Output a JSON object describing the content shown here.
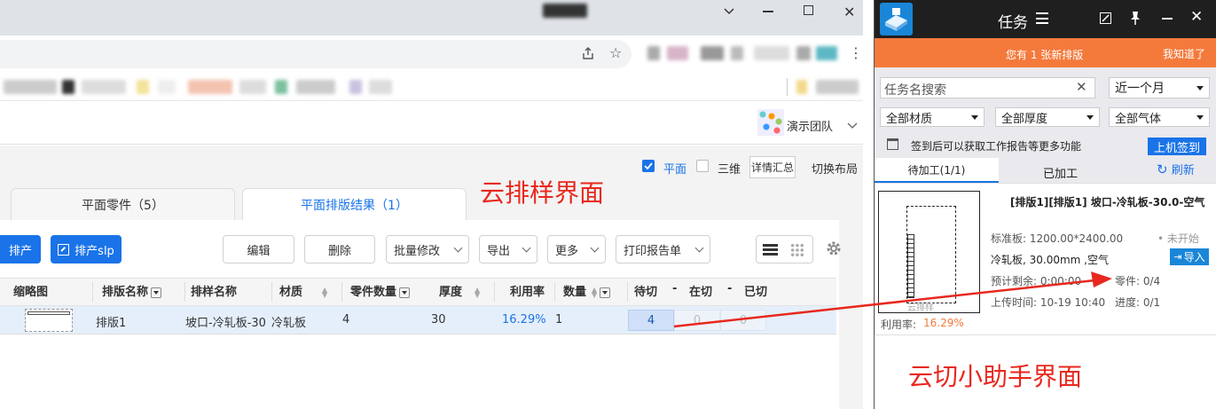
{
  "browser": {
    "window_controls": [
      "minimize",
      "maximize",
      "close"
    ]
  },
  "app": {
    "team_name": "演示团队",
    "view": {
      "flat_label": "平面",
      "threed_label": "三维",
      "detail_label": "详情汇总",
      "switch_layout": "切换布局"
    },
    "tabs": [
      {
        "label": "平面零件（5）"
      },
      {
        "label": "平面排版结果（1）"
      }
    ],
    "annotation_left": "云排样界面",
    "annotation_right": "云切小助手界面",
    "toolbar": {
      "produce": "排产",
      "produce_slp": "排产slp",
      "edit": "编辑",
      "delete": "删除",
      "batch_edit": "批量修改",
      "export": "导出",
      "more": "更多",
      "print_report": "打印报告单"
    },
    "table": {
      "headers": {
        "thumbnail": "缩略图",
        "layout_name": "排版名称",
        "sample_name": "排样名称",
        "material": "材质",
        "part_qty": "零件数量",
        "thickness": "厚度",
        "utilization": "利用率",
        "quantity": "数量",
        "to_cut": "待切",
        "cutting": "在切",
        "cut_done": "已切",
        "sep1": "-",
        "sep2": "-"
      },
      "rows": [
        {
          "layout_name": "排版1",
          "sample_name": "坡口-冷轧板-30",
          "material": "冷轧板",
          "part_qty": "4",
          "thickness": "30",
          "utilization": "16.29%",
          "quantity": "1",
          "to_cut": "4",
          "cutting": "0",
          "cut_done": "0"
        }
      ]
    }
  },
  "assistant": {
    "title": "任务",
    "notice": "您有 1 张新排版",
    "notice_ack": "我知道了",
    "search_placeholder": "任务名搜索",
    "period": "近一个月",
    "material_filter": "全部材质",
    "thickness_filter": "全部厚度",
    "gas_filter": "全部气体",
    "signin_hint": "签到后可以获取工作报告等更多功能",
    "signin_button": "上机签到",
    "tabs": {
      "pending": "待加工(1/1)",
      "done": "已加工",
      "refresh": "刷新"
    },
    "task": {
      "title": "[排版1][排版1] 坡口-冷轧板-30.0-空气",
      "spec": "标准板: 1200.00*2400.00",
      "status": "• 未开始",
      "material": "冷轧板, 30.00mm ,空气",
      "import": "导入",
      "remaining": "预计剩余: 0:00:00",
      "parts": "零件: 0/4",
      "upload": "上传时间: 10-19 10:40",
      "progress": "进度: 0/1",
      "thumb_label": "云排样",
      "utilization_label": "利用率:",
      "utilization": "16.29%"
    }
  },
  "colors": {
    "accent": "#1a73e8",
    "notice_bar": "#f47a3c",
    "assistant_header": "#1f1f1f",
    "annotation": "#e8281e",
    "to_cut_bg": "#cfe0f8"
  }
}
